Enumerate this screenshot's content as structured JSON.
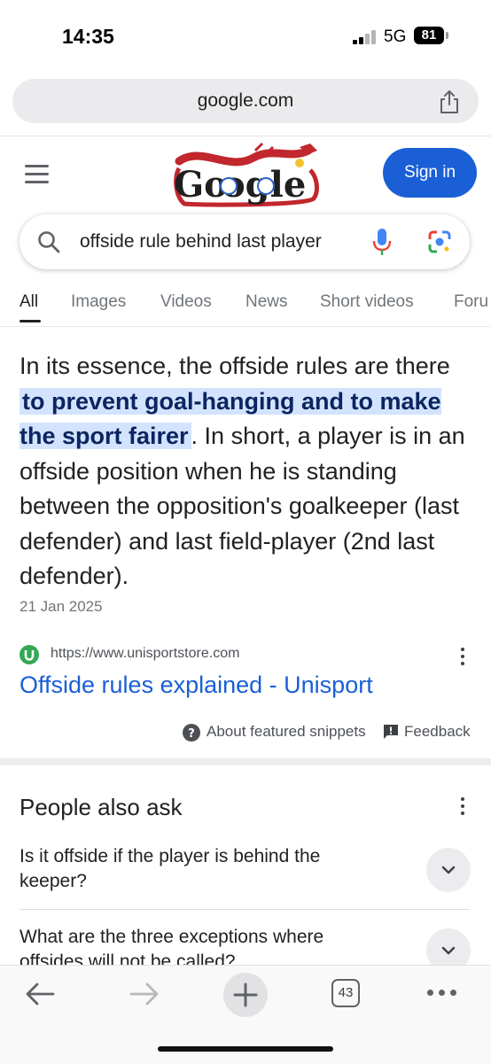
{
  "status_bar": {
    "time": "14:35",
    "network": "5G",
    "battery": "81"
  },
  "browser": {
    "url": "google.com"
  },
  "header": {
    "doodle_text": "Google",
    "signin_label": "Sign in"
  },
  "search": {
    "query": "offside rule behind last player"
  },
  "tabs": [
    {
      "label": "All",
      "active": true
    },
    {
      "label": "Images"
    },
    {
      "label": "Videos"
    },
    {
      "label": "News"
    },
    {
      "label": "Short videos"
    },
    {
      "label": "Foru"
    }
  ],
  "snippet": {
    "before": "In its essence, the offside rules are there ",
    "highlight": "to prevent goal-hanging and to make the sport fairer",
    "after": ". In short, a player is in an offside position when he is standing between the opposition's goalkeeper (last defender) and last field-player (2nd last defender).",
    "date": "21 Jan 2025",
    "site_url": "https://www.unisportstore.com",
    "title": "Offside rules explained - Unisport",
    "about_label": "About featured snippets",
    "feedback_label": "Feedback"
  },
  "people_also_ask": {
    "title": "People also ask",
    "questions": [
      "Is it offside if the player is behind the keeper?",
      "What are the three exceptions where offsides will not be called?"
    ]
  },
  "bottom_bar": {
    "tab_count": "43"
  },
  "colors": {
    "accent_blue": "#1a5fd6",
    "highlight_bg": "#d3e3fd"
  }
}
